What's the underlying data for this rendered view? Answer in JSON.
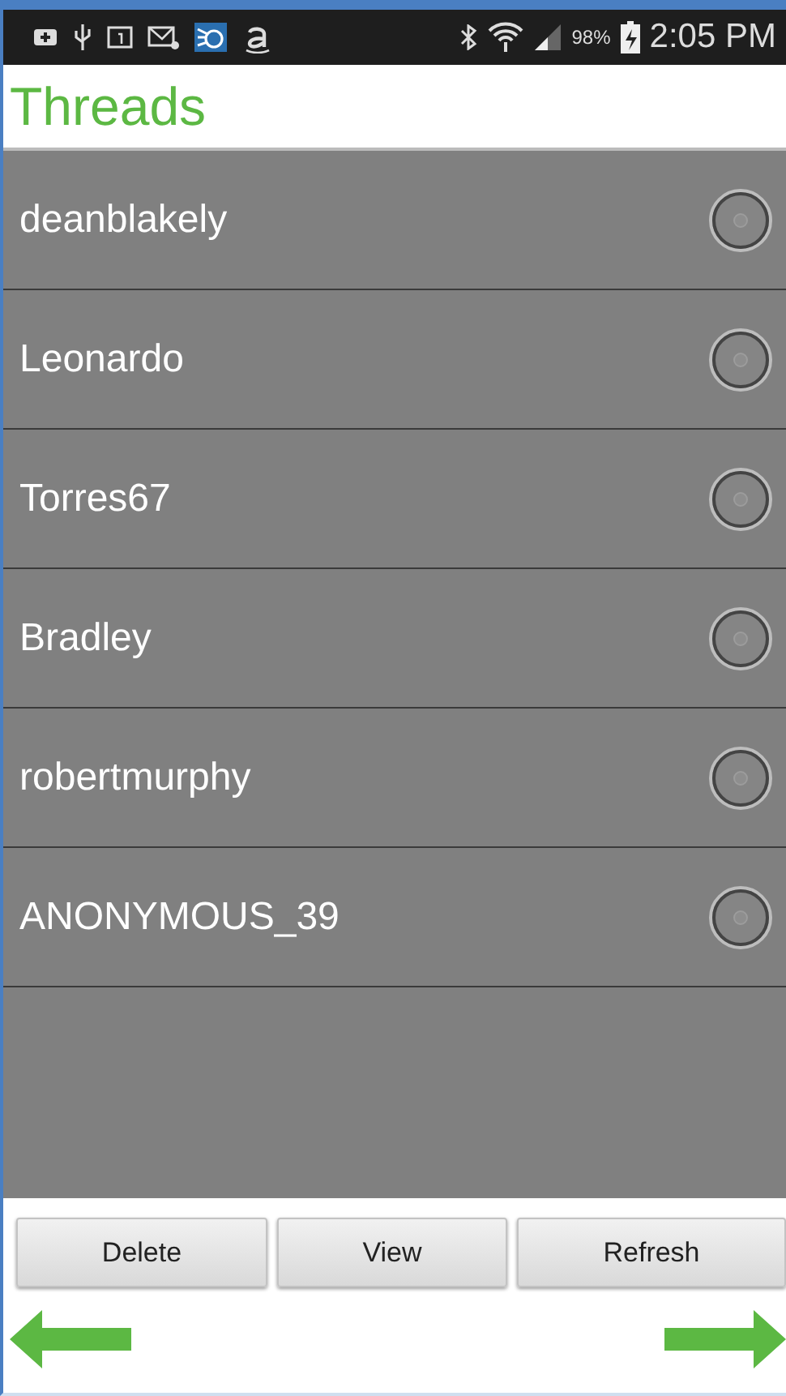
{
  "status_bar": {
    "battery": "98%",
    "time": "2:05 PM"
  },
  "title": "Threads",
  "threads": [
    {
      "name": "deanblakely",
      "selected": false
    },
    {
      "name": "Leonardo",
      "selected": false
    },
    {
      "name": "Torres67",
      "selected": false
    },
    {
      "name": "Bradley",
      "selected": false
    },
    {
      "name": "robertmurphy",
      "selected": false
    },
    {
      "name": "ANONYMOUS_39",
      "selected": false
    }
  ],
  "buttons": [
    "Delete",
    "View",
    "Refresh"
  ]
}
